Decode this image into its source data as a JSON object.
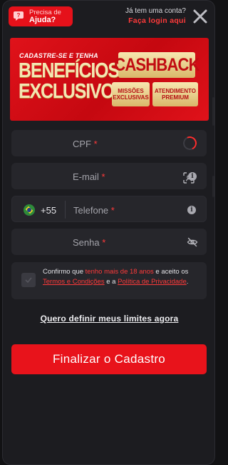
{
  "header": {
    "help_line1": "Precisa de",
    "help_line2": "Ajuda?",
    "login_question": "Já tem uma conta?",
    "login_link": "Faça login aqui"
  },
  "banner": {
    "tagline": "CADASTRE-SE E TENHA",
    "title": "BENEFÍCIOS EXCLUSIVOS",
    "badge_main": "CASHBACK",
    "badge_1": "MISSÕES EXCLUSIVAS",
    "badge_2": "ATENDIMENTO PREMIUM"
  },
  "form": {
    "cpf_label": "CPF",
    "email_label": "E-mail",
    "phone_ddi": "+55",
    "phone_label": "Telefone",
    "password_label": "Senha",
    "required_mark": "*"
  },
  "consent": {
    "part1": "Confirmo que ",
    "age_text": "tenho mais de 18 anos",
    "part2": " e aceito os ",
    "terms_link": "Termos e Condições",
    "part3": " e a ",
    "privacy_link": "Política de Privacidade",
    "part4": "."
  },
  "limits_link": "Quero definir meus limites agora",
  "submit_label": "Finalizar o Cadastro",
  "icons": {
    "help": "help-chat-icon",
    "close": "close-icon",
    "cpf_status": "loading-spinner-icon",
    "email": "face-scan-icon",
    "info": "info-icon",
    "flag": "brazil-flag-icon",
    "password": "eye-off-icon",
    "checkbox": "check-icon"
  },
  "colors": {
    "accent": "#e8131b",
    "background": "#1c1c20",
    "field": "#26262b",
    "link": "#ff3a3a"
  }
}
